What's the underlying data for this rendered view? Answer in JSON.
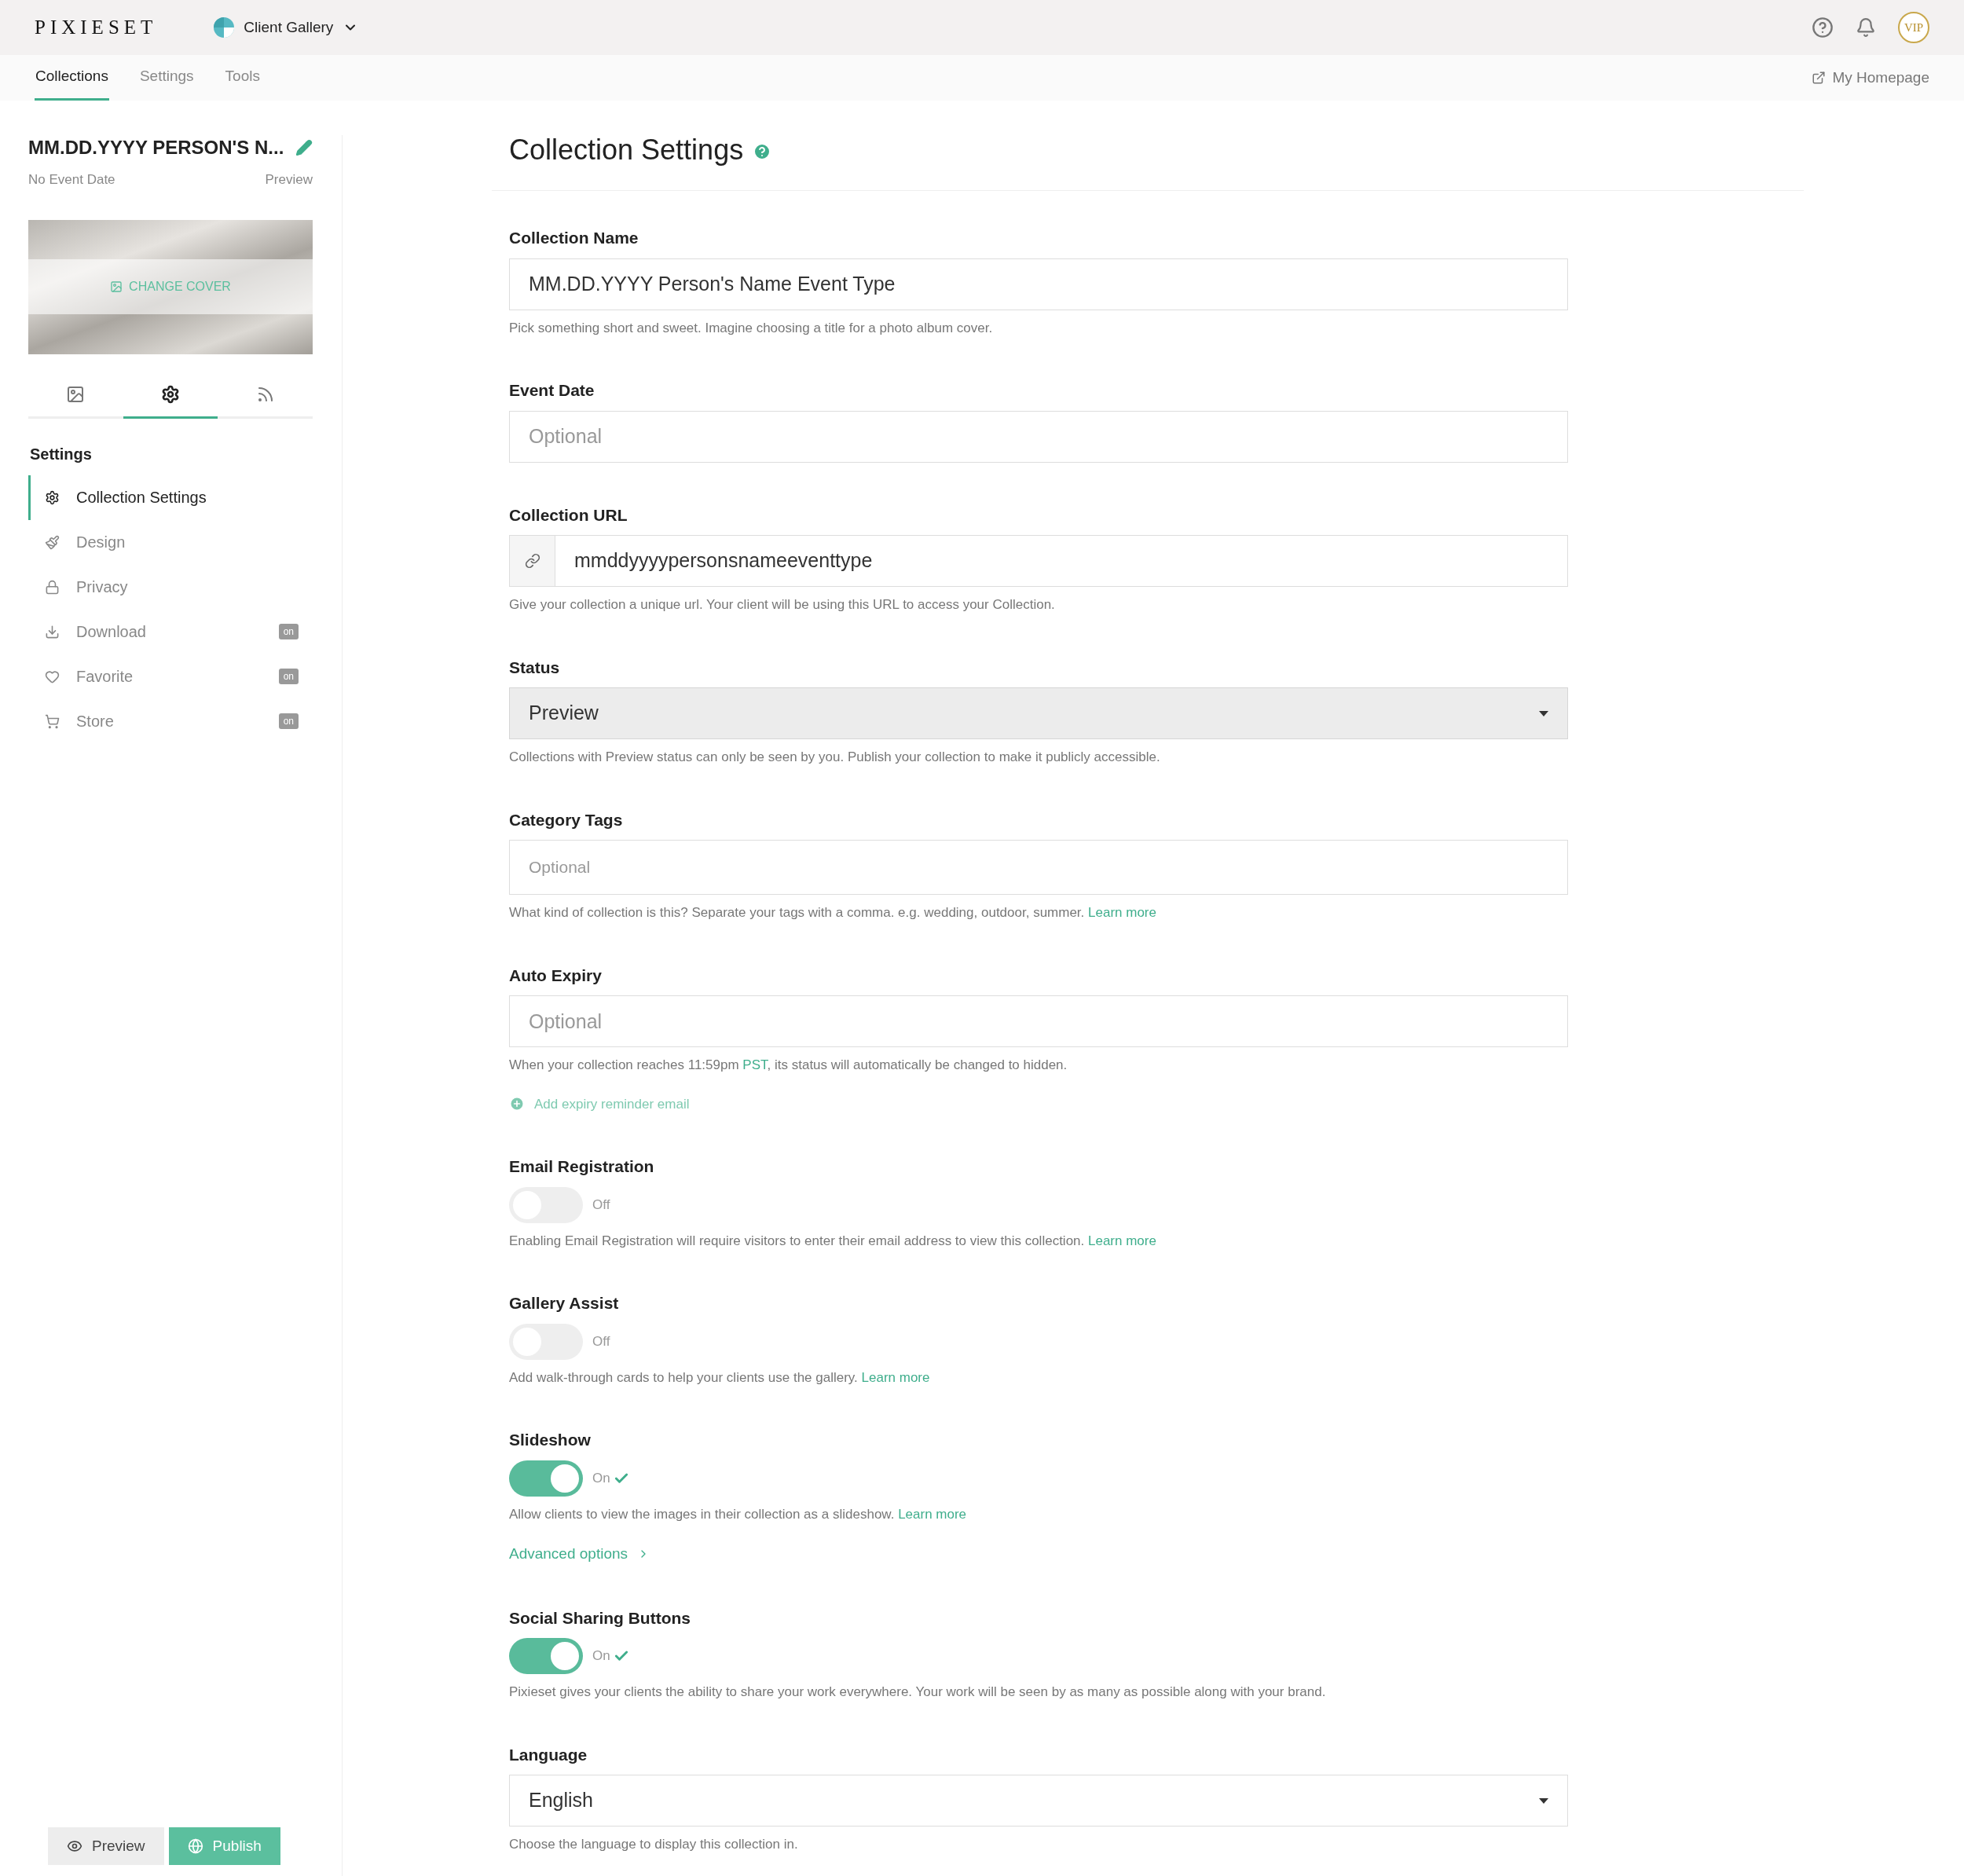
{
  "header": {
    "logo": "PIXIESET",
    "app": "Client Gallery",
    "avatar": "VIP"
  },
  "nav": {
    "tabs": [
      {
        "label": "Collections",
        "selected": true
      },
      {
        "label": "Settings",
        "selected": false
      },
      {
        "label": "Tools",
        "selected": false
      }
    ],
    "homepage": "My Homepage"
  },
  "sidebar": {
    "title": "MM.DD.YYYY PERSON'S N...",
    "date": "No Event Date",
    "status": "Preview",
    "cover_button": "CHANGE COVER",
    "icon_tabs": [
      {
        "selected": false
      },
      {
        "selected": true
      },
      {
        "selected": false
      }
    ],
    "section": "Settings",
    "items": [
      {
        "label": "Collection Settings",
        "selected": true
      },
      {
        "label": "Design",
        "selected": false
      },
      {
        "label": "Privacy",
        "selected": false
      },
      {
        "label": "Download",
        "selected": false,
        "badge": "on"
      },
      {
        "label": "Favorite",
        "selected": false,
        "badge": "on"
      },
      {
        "label": "Store",
        "selected": false,
        "badge": "on"
      }
    ],
    "preview_button": "Preview",
    "publish_button": "Publish"
  },
  "main": {
    "title": "Collection Settings",
    "fields": [
      {
        "kind": "input",
        "label": "Collection Name",
        "value": "MM.DD.YYYY Person's Name Event Type",
        "help": [
          {
            "kind": "text",
            "text": "Pick something short and sweet. Imagine choosing a title for a photo album cover."
          }
        ]
      },
      {
        "kind": "input",
        "label": "Event Date",
        "placeholder": "Optional"
      },
      {
        "kind": "url",
        "label": "Collection URL",
        "value": "mmddyyyypersonsnameeventtype",
        "help": [
          {
            "kind": "text",
            "text": "Give your collection a unique url. Your client will be using this URL to access your Collection."
          }
        ]
      },
      {
        "kind": "select",
        "label": "Status",
        "value": "Preview",
        "disabled": true,
        "help": [
          {
            "kind": "text",
            "text": "Collections with Preview status can only be seen by you. Publish your collection to make it publicly accessible."
          }
        ]
      },
      {
        "kind": "input",
        "label": "Category Tags",
        "placeholder": "Optional",
        "small": true,
        "help": [
          {
            "kind": "text",
            "text": "What kind of collection is this? Separate your tags with a comma. e.g. wedding, outdoor, summer. "
          },
          {
            "kind": "link",
            "text": "Learn more"
          }
        ]
      },
      {
        "kind": "input",
        "label": "Auto Expiry",
        "placeholder": "Optional",
        "help": [
          {
            "kind": "text",
            "text": "When your collection reaches 11:59pm "
          },
          {
            "kind": "link",
            "text": "PST"
          },
          {
            "kind": "text",
            "text": ", its status will automatically be changed to hidden."
          }
        ],
        "action": "Add expiry reminder email"
      },
      {
        "kind": "toggle",
        "label": "Email Registration",
        "on": false,
        "state": "Off",
        "help": [
          {
            "kind": "text",
            "text": "Enabling Email Registration will require visitors to enter their email address to view this collection. "
          },
          {
            "kind": "link",
            "text": "Learn more"
          }
        ]
      },
      {
        "kind": "toggle",
        "label": "Gallery Assist",
        "on": false,
        "state": "Off",
        "help": [
          {
            "kind": "text",
            "text": "Add walk-through cards to help your clients use the gallery. "
          },
          {
            "kind": "link",
            "text": "Learn more"
          }
        ]
      },
      {
        "kind": "toggle",
        "label": "Slideshow",
        "on": true,
        "state": "On",
        "help": [
          {
            "kind": "text",
            "text": "Allow clients to view the images in their collection as a slideshow. "
          },
          {
            "kind": "link",
            "text": "Learn more"
          }
        ],
        "more": "Advanced options"
      },
      {
        "kind": "toggle",
        "label": "Social Sharing Buttons",
        "on": true,
        "state": "On",
        "help": [
          {
            "kind": "text",
            "text": "Pixieset gives your clients the ability to share your work everywhere. Your work will be seen by as many as possible along with your brand."
          }
        ]
      },
      {
        "kind": "select",
        "label": "Language",
        "value": "English",
        "disabled": false,
        "help": [
          {
            "kind": "text",
            "text": "Choose the language to display this collection in."
          }
        ]
      }
    ]
  }
}
